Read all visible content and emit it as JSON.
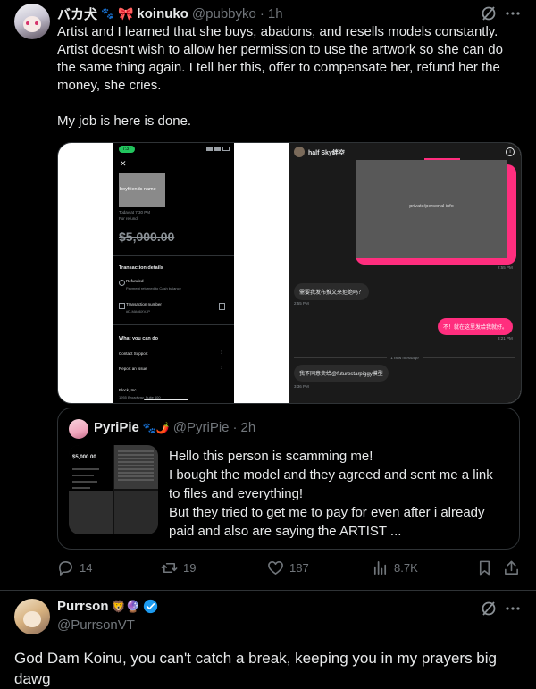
{
  "tweet": {
    "display_name": "バカ犬",
    "emoji_1": "🐾",
    "emoji_2": "🎀",
    "emoji_3": "koinuko",
    "handle": "@pubbyko",
    "dot": "·",
    "time": "1h",
    "text_line1": "Artist and I learned that she buys, abadons, and resells models constantly.",
    "text_line2": "Artist doesn't wish to allow her permission to use the artwork so she can do",
    "text_line3": "the same thing again. I tell her this, offer to compensate her, refund her the",
    "text_line4": "money, she cries.",
    "text_line5": "My job is here is done."
  },
  "screenshot_left": {
    "status_time": "7:37",
    "close_glyph": "✕",
    "label": "boyfriends name",
    "date": "Today at 7:30 PM",
    "for": "For refund",
    "amount": "$5,000.00",
    "section_title": "Transaction details",
    "refunded": "Refunded",
    "refunded_sub": "Payment returned to Cash balance",
    "txn_label": "Transaction number",
    "txn_value": "#D-MA66XVJP",
    "what_title": "What you can do",
    "contact": "Contact Support",
    "report": "Report an issue",
    "company": "Block, Inc.",
    "address": "1955 Broadway, Suite 600"
  },
  "screenshot_right": {
    "name": "half Sky絆空",
    "private": "private/personal info",
    "time1": "2:55 PM",
    "msg1": "需要我发布推文来拒绝吗？",
    "time2": "2:55 PM",
    "msg2": "不！就在这里发给我就好。",
    "time3": "3:21 PM",
    "new_message": "1 new message",
    "msg3": "我不同意卖给@futurestarpiggy模型",
    "time4": "3:36 PM"
  },
  "quote": {
    "display_name": "PyriPie",
    "emoji": "🐾🌶️",
    "handle": "@PyriPie",
    "dot": "·",
    "time": "2h",
    "thumb_amount": "$5,000.00",
    "text_line1": "Hello this person is scamming me!",
    "text_line2": "I bought the model and they agreed and sent me a link",
    "text_line3": "to files and everything!",
    "text_line4": "But they tried to get me to pay for even after i already",
    "text_line5": "paid and also are saying the ARTIST ..."
  },
  "actions": {
    "replies": "14",
    "reposts": "19",
    "likes": "187",
    "views": "8.7K"
  },
  "reply": {
    "display_name": "Purrson",
    "emoji": "🦁🔮",
    "handle": "@PurrsonVT",
    "text": "God Dam Koinu, you can't catch a break, keeping you in my prayers big dawg"
  },
  "colors": {
    "pink": "#ff2e7e",
    "verified": "#1d9bf0"
  }
}
